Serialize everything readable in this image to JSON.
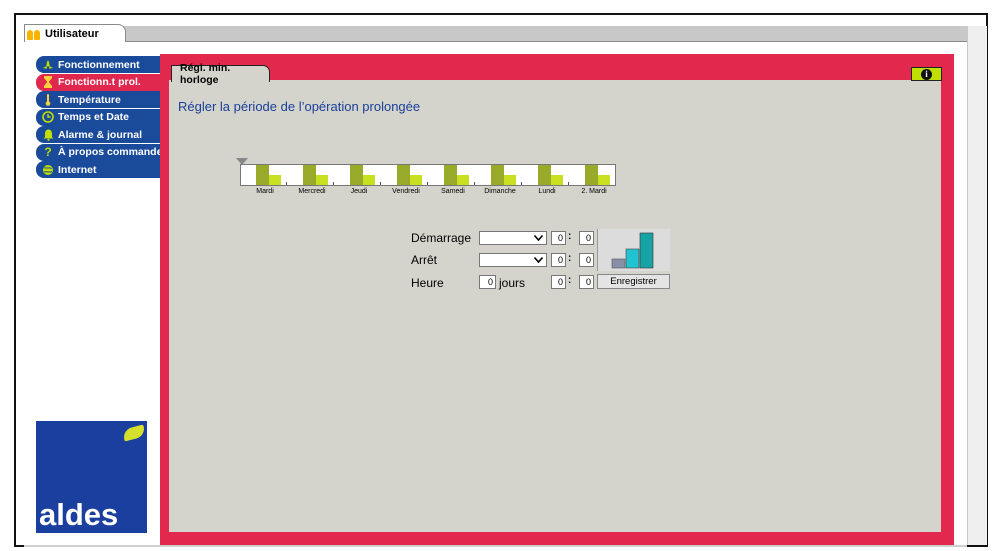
{
  "top": {
    "user_tab": "Utilisateur"
  },
  "sidebar": {
    "items": [
      {
        "label": "Fonctionnement",
        "icon": "fan-icon",
        "active": false
      },
      {
        "label": "Fonctionn.t prol.",
        "icon": "hourglass-icon",
        "active": true
      },
      {
        "label": "Température",
        "icon": "thermometer-icon",
        "active": false
      },
      {
        "label": "Temps et Date",
        "icon": "clock-icon",
        "active": false
      },
      {
        "label": "Alarme & journal",
        "icon": "bell-icon",
        "active": false
      },
      {
        "label": "À propos commande",
        "icon": "question-icon",
        "active": false
      },
      {
        "label": "Internet",
        "icon": "globe-icon",
        "active": false
      }
    ]
  },
  "logo": {
    "text": "aldes"
  },
  "content": {
    "tab": "Régl. min. horloge",
    "heading": "Régler la période de l’opération prolongée"
  },
  "timeline": {
    "days": [
      "Mardi",
      "Mercredi",
      "Jeudi",
      "Vendredi",
      "Samedi",
      "Dimanche",
      "Lundi",
      "2. Mardi"
    ]
  },
  "form": {
    "start_label": "Démarrage",
    "stop_label": "Arrêt",
    "time_label": "Heure",
    "start_select": "",
    "stop_select": "",
    "start_hour": "0",
    "start_min": "0",
    "stop_hour": "0",
    "stop_min": "0",
    "days_value": "0",
    "days_unit": "jours",
    "time_hour": "0",
    "time_min": "0",
    "save_label": "Enregistrer",
    "colon": ":"
  },
  "colors": {
    "accent_red": "#e3284d",
    "nav_blue": "#1a4a9a",
    "bar_olive": "#99aa2a",
    "bar_lime": "#c8e020",
    "chart_grey": "#8890a8",
    "chart_cyan": "#21c3d0",
    "chart_teal": "#17a3a3"
  }
}
